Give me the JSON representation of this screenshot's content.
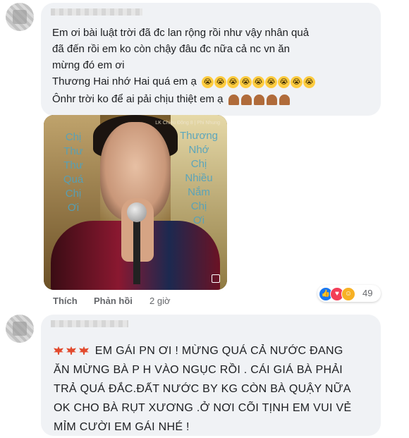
{
  "comment1": {
    "lines": [
      "Em ơi bài luật trời đã đc lan rộng rồi như vậy nhân quả",
      "đã đến rồi em ko còn chậy đâu đc nữa cả nc vn ăn",
      "mừng đó em ơi"
    ],
    "line4_text": "Thương Hai nhớ Hai quá em ạ",
    "line4_emoji": "loudly-crying-face",
    "line4_emoji_count": 9,
    "line5_text": "Ônhr trời ko để ai pải chịu thiệt em ạ",
    "line5_emoji": "folded-hands",
    "line5_emoji_count": 5,
    "video": {
      "caption": "LK Chiều Đông 8 | Phi Nhung",
      "lyric_left": "Chị\nThư\nThư\nQuá\nChị\nƠi",
      "lyric_right": "Thương\nNhớ\nChị\nNhiều\nNắm\nChị\nƠi"
    },
    "actions": {
      "like": "Thích",
      "reply": "Phản hồi",
      "time": "2 giờ"
    },
    "reactions": {
      "types": [
        "like",
        "love",
        "care"
      ],
      "count": "49"
    }
  },
  "comment2": {
    "lines": [
      "EM GÁI PN ƠI ! MỪNG QUÁ CẢ NƯỚC ĐANG",
      "ĂN MỪNG BÀ P H VÀO NGỤC RỒI . CÁI GIÁ BÀ PHẢI",
      "TRẢ QUÁ ĐẮC.ĐẤT NƯỚC BY KG CÒN BÀ QUẬY NỮA",
      "OK CHO BÀ RỤT XƯƠNG .Ở NƠI CÕI TỊNH EM VUI VẺ",
      "MỈM CƯỜI EM GÁI NHÉ !"
    ],
    "leaf_emoji": "maple-leaf",
    "leaf_count": 3
  },
  "colors": {
    "bubble": "#f0f2f5",
    "text": "#1c1e21",
    "meta": "#65676b",
    "like_blue": "#1877f2",
    "love_red": "#f33e58",
    "care_yellow": "#f7b125"
  }
}
